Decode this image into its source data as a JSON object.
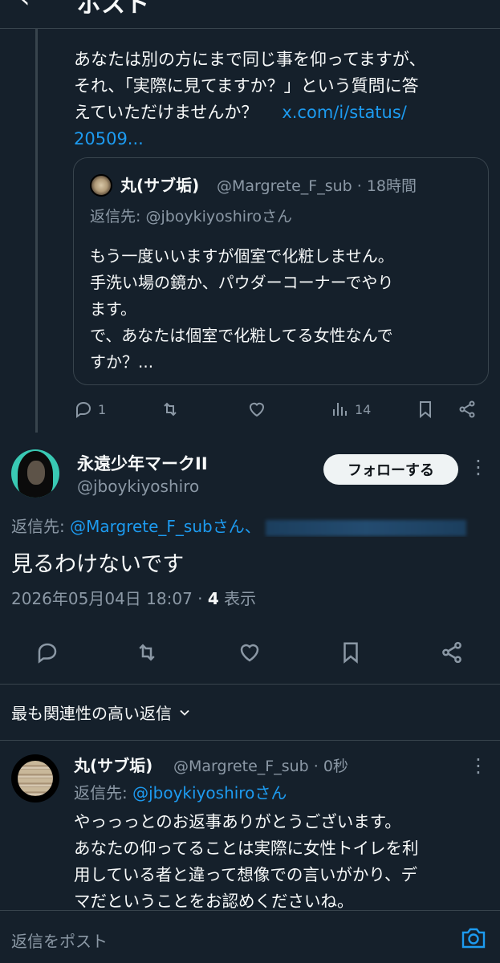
{
  "header": {
    "back_glyph": "‹",
    "title": "ポスト"
  },
  "tweet1": {
    "lines": [
      "あなたは別の方にまで同じ事を仰ってますが、",
      "それ、「実際に見てますか？」という質問に答",
      "えていただけませんか？"
    ],
    "link_part1": "x.com/i/status/",
    "link_part2": "20509..."
  },
  "quote": {
    "name": "丸(サブ垢)",
    "meta": "@Margrete_F_sub · 18時間",
    "reply_to": "返信先: @jboykiyoshiroさん",
    "body_lines": [
      "もう一度いいますが個室で化粧しません。",
      "手洗い場の鏡か、パウダーコーナーでやり",
      "ます。",
      "で、あなたは個室で化粧してる女性なんで",
      "すか？..."
    ]
  },
  "tweet1_actions": {
    "reply_count": "1",
    "views_count": "14"
  },
  "main": {
    "name": "永遠少年マークII",
    "handle": "@jboykiyoshiro",
    "follow_label": "フォローする",
    "more_glyph": "⋮",
    "reply_prefix": "返信先: ",
    "reply_to": "@Margrete_F_subさん、",
    "text": "見るわけないです",
    "timestamp": "2026年05月04日 18:07 · ",
    "views": "4",
    "views_label": " 表示"
  },
  "sort": {
    "label": "最も関連性の高い返信"
  },
  "reply": {
    "name": "丸(サブ垢)",
    "meta": "@Margrete_F_sub · 0秒",
    "more_glyph": "⋮",
    "reply_prefix": "返信先: ",
    "reply_to": "@jboykiyoshiroさん",
    "body_lines": [
      "やっっっとのお返事ありがとうございます。",
      "あなたの仰ってることは実際に女性トイレを利",
      "用している者と違って想像での言いがかり、デ",
      "マだということをお認めくださいね。"
    ]
  },
  "compose": {
    "placeholder": "返信をポスト"
  },
  "colors": {
    "background": "#15202b",
    "link": "#1d9bf0",
    "muted": "#8b98a5",
    "divider": "#38444d"
  },
  "icons": [
    "back-icon",
    "reply-icon",
    "retweet-icon",
    "like-icon",
    "views-icon",
    "bookmark-icon",
    "share-icon",
    "chevron-down-icon",
    "more-icon",
    "camera-icon"
  ]
}
